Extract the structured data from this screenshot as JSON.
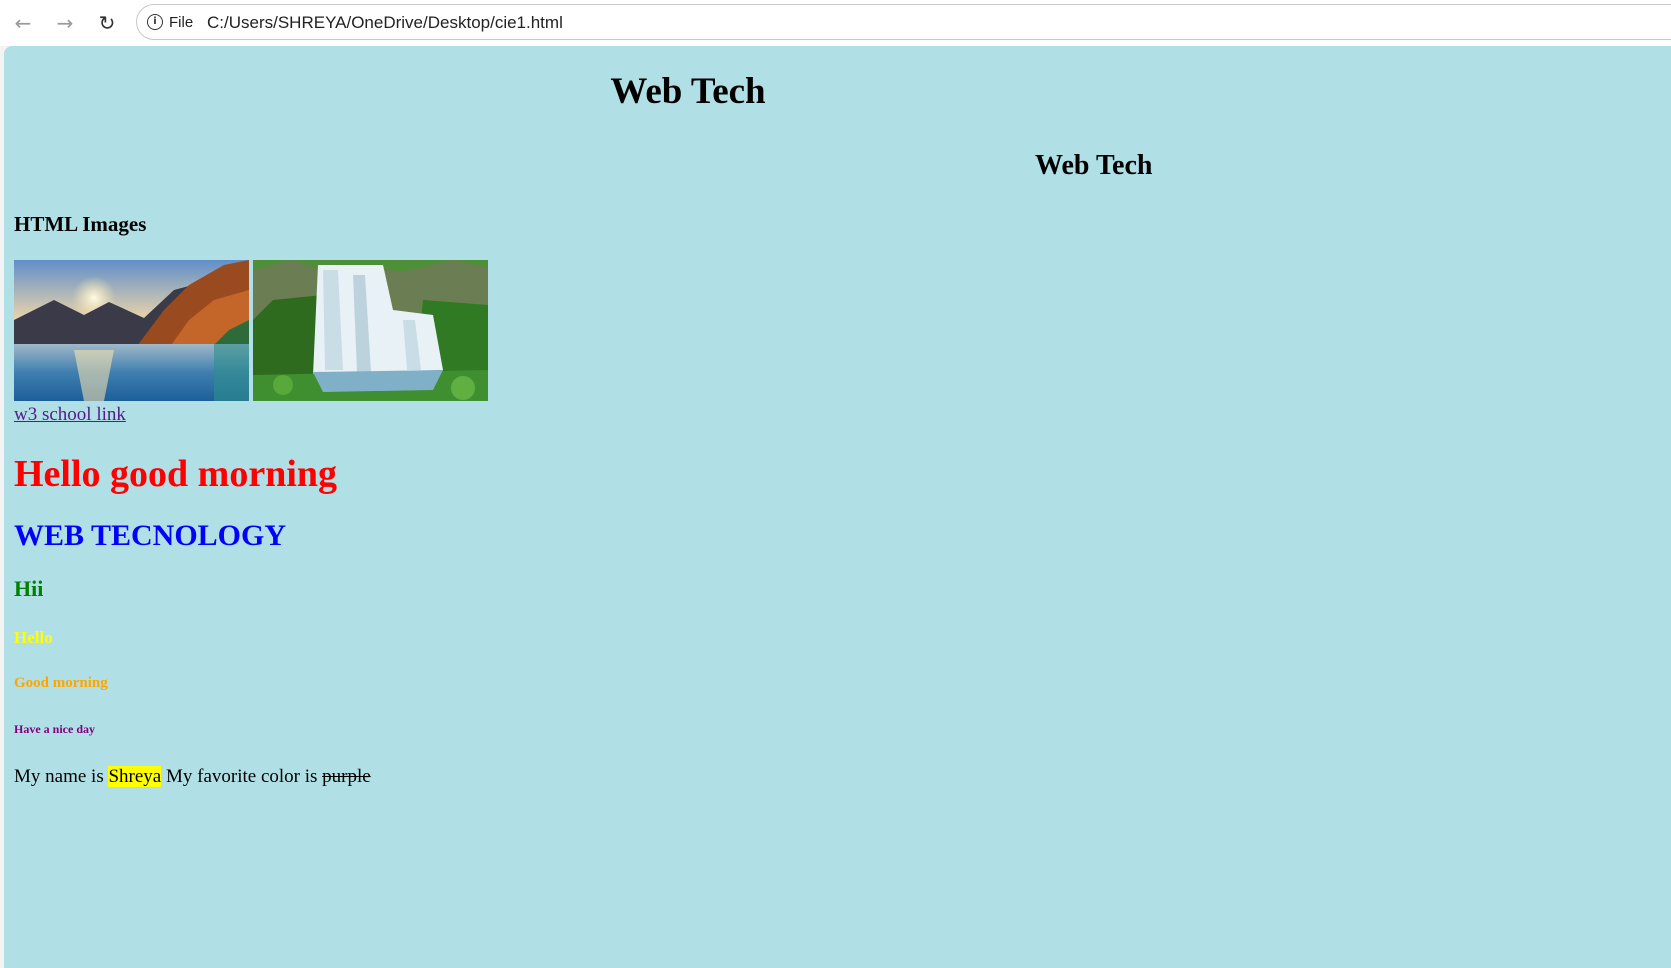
{
  "browser": {
    "back_icon": "back-arrow-icon",
    "forward_icon": "forward-arrow-icon",
    "reload_icon": "reload-icon",
    "site_info_icon": "info-icon",
    "scheme_label": "File",
    "url": "C:/Users/SHREYA/OneDrive/Desktop/cie1.html"
  },
  "page": {
    "background_color": "#b0dfe5",
    "heading_main": "Web Tech",
    "heading_right": "Web Tech",
    "images_heading": "HTML Images",
    "images": [
      {
        "depicts": "mountain-lake-sunset"
      },
      {
        "depicts": "waterfall"
      }
    ],
    "link_text": "w3 school link",
    "headings": [
      {
        "text": "Hello good morning",
        "color": "#ff0000"
      },
      {
        "text": "WEB TECNOLOGY",
        "color": "#0000ff"
      },
      {
        "text": "Hii",
        "color": "#008000"
      },
      {
        "text": "Hello",
        "color": "#ffff00"
      },
      {
        "text": "Good morning",
        "color": "#ffa500"
      },
      {
        "text": "Have a nice day",
        "color": "#800080"
      }
    ],
    "paragraph": {
      "prefix": "My name is ",
      "highlighted_name": "Shreya",
      "middle": " My favorite color is ",
      "struck_color": "purple",
      "highlight_color": "#ffff00"
    }
  }
}
